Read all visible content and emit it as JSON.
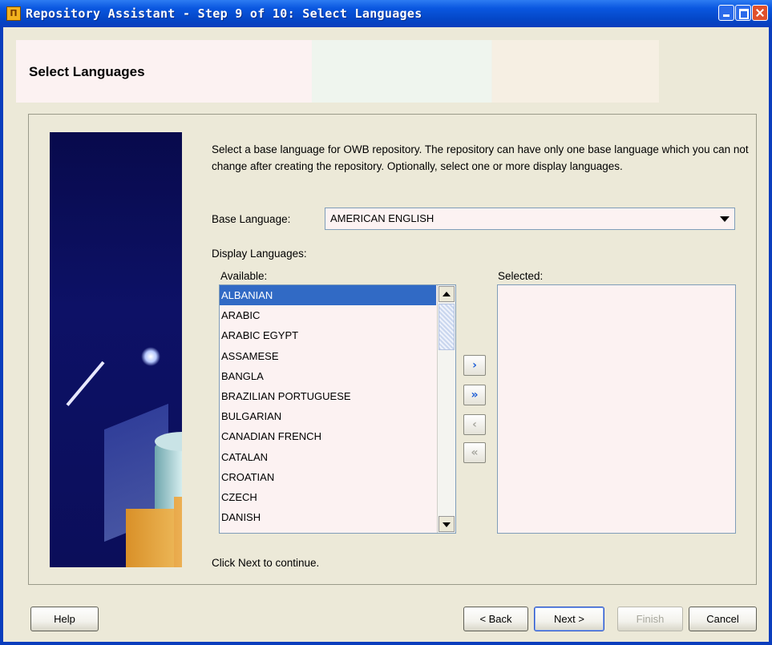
{
  "window": {
    "title": "Repository Assistant - Step 9 of 10: Select Languages",
    "app_icon_glyph": "П"
  },
  "header": {
    "title": "Select Languages"
  },
  "intro_text": "Select a base language for OWB repository. The repository can have only one base language which you can not change after creating the repository.  Optionally, select one or more display languages.",
  "base_language": {
    "label": "Base Language:",
    "value": "AMERICAN ENGLISH"
  },
  "display_languages": {
    "label": "Display Languages:",
    "available_label": "Available:",
    "selected_label": "Selected:",
    "available": [
      "ALBANIAN",
      "ARABIC",
      "ARABIC EGYPT",
      "ASSAMESE",
      "BANGLA",
      "BRAZILIAN PORTUGUESE",
      "BULGARIAN",
      "CANADIAN FRENCH",
      "CATALAN",
      "CROATIAN",
      "CZECH",
      "DANISH"
    ],
    "selected": [],
    "highlighted_index": 0
  },
  "move_buttons": {
    "add": "›",
    "add_all": "»",
    "remove": "‹",
    "remove_all": "«"
  },
  "footer_msg": "Click Next to continue.",
  "buttons": {
    "help": "Help",
    "back": "< Back",
    "next": "Next >",
    "finish": "Finish",
    "cancel": "Cancel"
  },
  "colors": {
    "accent": "#316ac5",
    "titlebar": "#0a57e0",
    "list_bg": "#fcf2f2"
  }
}
